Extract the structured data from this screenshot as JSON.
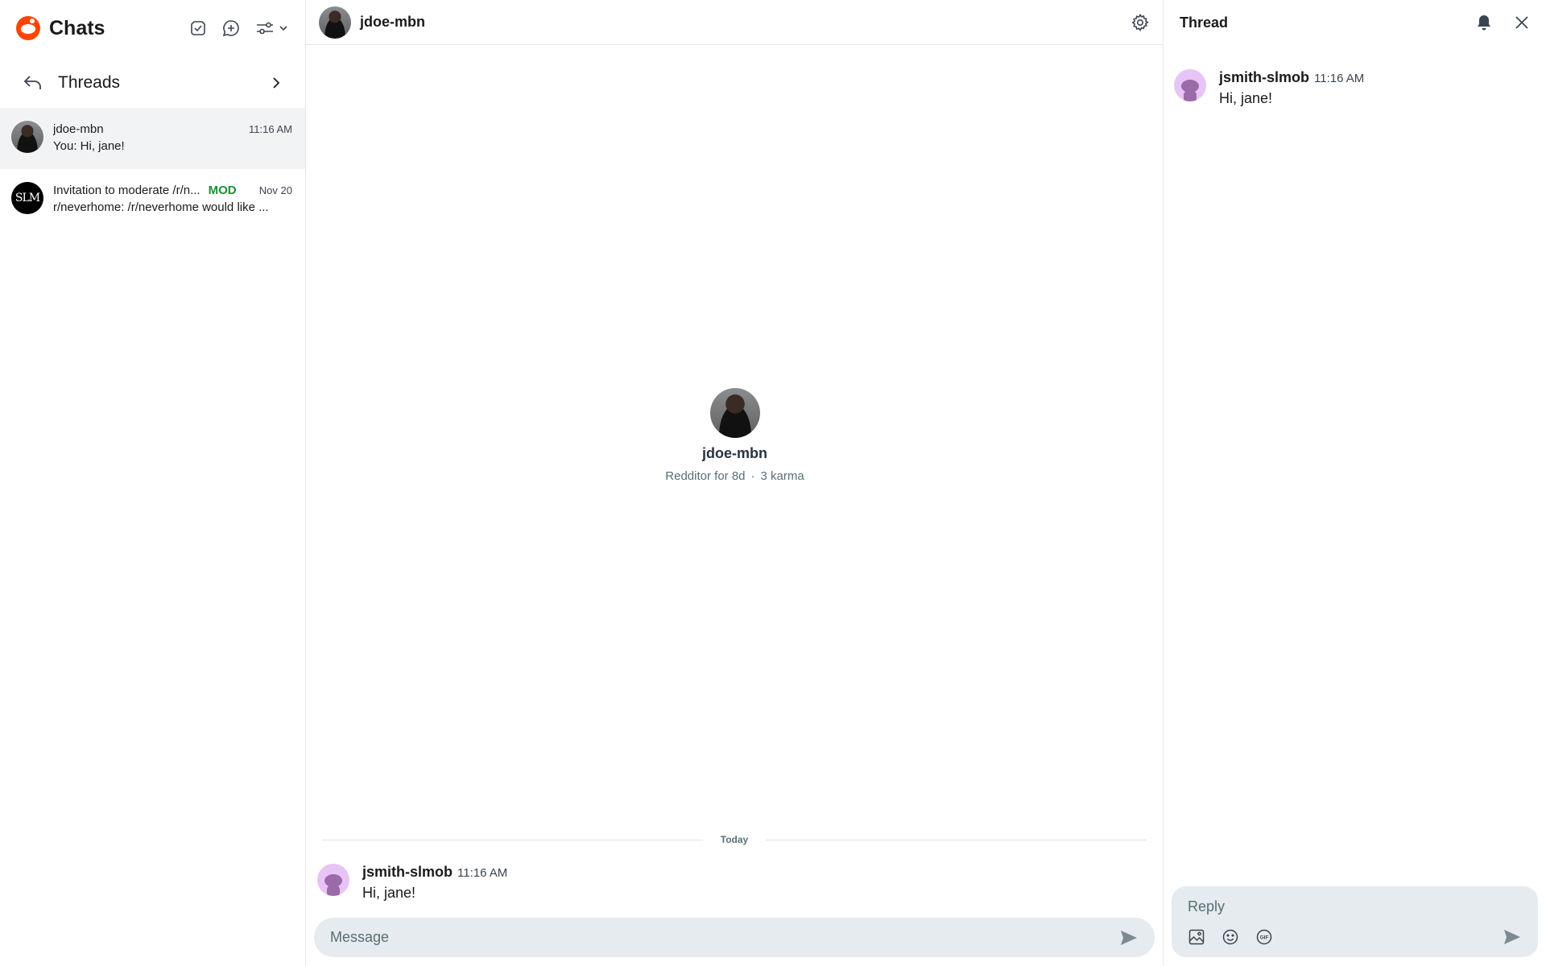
{
  "sidebar": {
    "title": "Chats",
    "threads_label": "Threads",
    "conversations": [
      {
        "name": "jdoe-mbn",
        "time": "11:16 AM",
        "preview": "You: Hi, jane!",
        "badge": ""
      },
      {
        "name": "Invitation to moderate /r/n...",
        "time": "Nov 20",
        "preview": "r/neverhome: /r/neverhome would like ...",
        "badge": "MOD",
        "avatar_text": "SLM"
      }
    ]
  },
  "chat": {
    "title": "jdoe-mbn",
    "profile": {
      "name": "jdoe-mbn",
      "age": "Redditor for 8d",
      "separator": "·",
      "karma": "3 karma"
    },
    "divider": "Today",
    "messages": [
      {
        "user": "jsmith-slmob",
        "time": "11:16 AM",
        "text": "Hi, jane!"
      }
    ],
    "composer_placeholder": "Message"
  },
  "thread": {
    "title": "Thread",
    "message": {
      "user": "jsmith-slmob",
      "time": "11:16 AM",
      "text": "Hi, jane!"
    },
    "reply_placeholder": "Reply",
    "gif_label": "GIF"
  },
  "colors": {
    "brand": "#ff4500",
    "mod_badge": "#1a8f37",
    "composer_bg": "#e5ebee",
    "active_row": "#f1f3f5"
  },
  "icons": [
    "reddit-logo-icon",
    "mark-read-icon",
    "new-chat-icon",
    "filter-icon",
    "chevron-down-icon",
    "back-arrow-icon",
    "chevron-right-icon",
    "gear-icon",
    "send-icon",
    "bell-icon",
    "close-icon",
    "image-icon",
    "emoji-icon",
    "gif-icon"
  ]
}
